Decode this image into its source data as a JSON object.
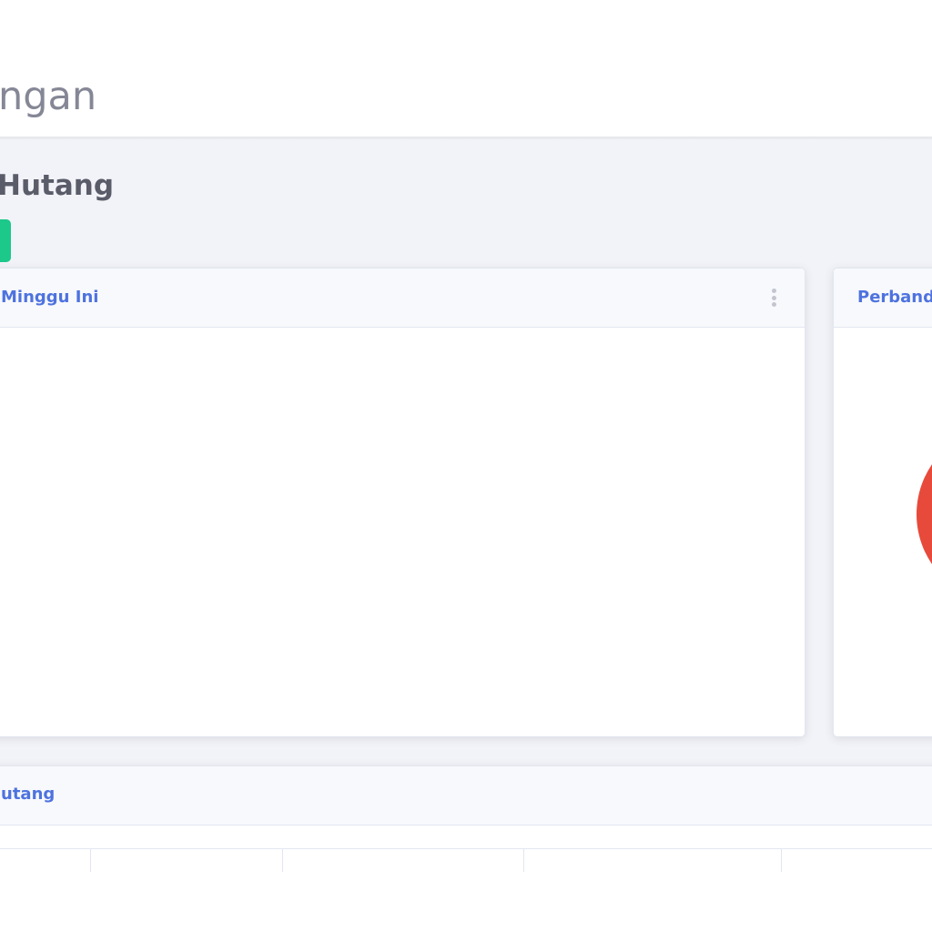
{
  "header": {
    "page_title": "ngan"
  },
  "section": {
    "title": "Hutang"
  },
  "weekly_card": {
    "title": "Minggu Ini"
  },
  "compare_card": {
    "title": "Perbandi",
    "chart_data": {
      "type": "pie",
      "slices": [
        {
          "value": 1,
          "color": "#e74a3b"
        }
      ]
    }
  },
  "table_card": {
    "title": "utang",
    "columns": [
      "",
      "",
      "",
      "",
      ""
    ]
  },
  "colors": {
    "primary": "#4e73df",
    "success": "#1cc88a",
    "danger": "#e74a3b",
    "muted": "#858796",
    "background": "#f2f3f8"
  }
}
